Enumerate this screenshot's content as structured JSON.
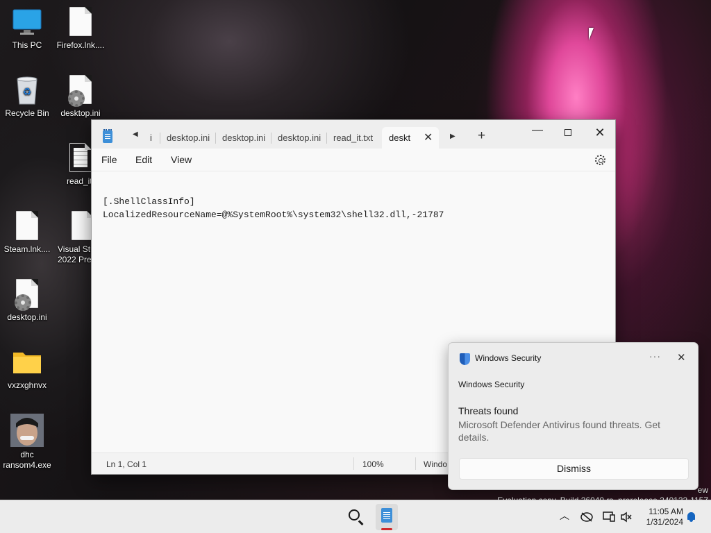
{
  "desktop": {
    "icons": [
      {
        "label": "This PC",
        "icon": "this-pc-icon"
      },
      {
        "label": "Firefox.lnk....",
        "icon": "file-icon"
      },
      {
        "label": "Recycle Bin",
        "icon": "recycle-bin-icon"
      },
      {
        "label": "desktop.ini",
        "icon": "settings-file-icon"
      },
      {
        "label": "read_it.",
        "icon": "text-file-icon"
      },
      {
        "label": "Steam.lnk....",
        "icon": "file-icon"
      },
      {
        "label": "Visual Stu",
        "label2": "2022 Prev",
        "icon": "file-icon"
      },
      {
        "label": "desktop.ini",
        "icon": "settings-file-icon"
      },
      {
        "label": "vxzxghnvx",
        "icon": "folder-icon"
      },
      {
        "label": "dhc",
        "label2": "ransom4.exe",
        "icon": "face-exe-icon"
      }
    ]
  },
  "notepad": {
    "tabs": [
      {
        "label": "i"
      },
      {
        "label": "desktop.ini"
      },
      {
        "label": "desktop.ini"
      },
      {
        "label": "desktop.ini"
      },
      {
        "label": "read_it.txt"
      },
      {
        "label": "deskt",
        "active": true
      }
    ],
    "menu": {
      "file": "File",
      "edit": "Edit",
      "view": "View"
    },
    "content": "[.ShellClassInfo]\nLocalizedResourceName=@%SystemRoot%\\system32\\shell32.dll,-21787",
    "status": {
      "position": "Ln 1, Col 1",
      "zoom": "100%",
      "line_ending": "Windo"
    }
  },
  "toast": {
    "app_name": "Windows Security",
    "more_label": "···",
    "close_label": "✕",
    "subheading": "Windows Security",
    "title": "Threats found",
    "body": "Microsoft Defender Antivirus found threats. Get details.",
    "dismiss_label": "Dismiss",
    "shield_color": "#1f5db8"
  },
  "watermark": {
    "line1": "ew",
    "line2": "Evaluation copy. Build 26040.rs_prerelease.240122-1157"
  },
  "taskbar": {
    "time": "11:05 AM",
    "date": "1/31/2024",
    "active_app_indicator_color": "#d02a2a"
  }
}
